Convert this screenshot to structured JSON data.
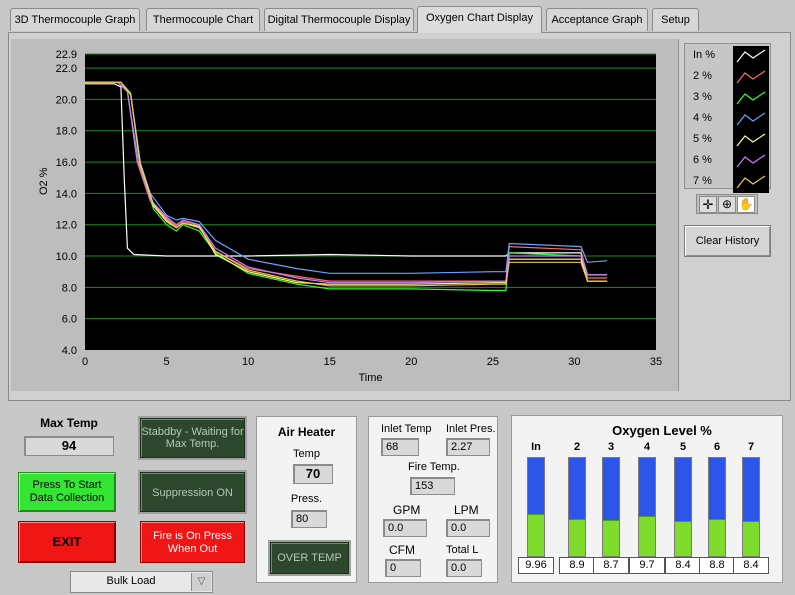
{
  "tabs": [
    "3D Thermocouple Graph",
    "Thermocouple Chart",
    "Digital Thermocouple Display",
    "Oxygen Chart Display",
    "Acceptance Graph",
    "Setup"
  ],
  "chart_data": {
    "type": "line",
    "xlabel": "Time",
    "ylabel": "O2 %",
    "xlim": [
      0,
      35
    ],
    "ylim": [
      4.0,
      22.9
    ],
    "x_ticks": [
      "0",
      "5",
      "10",
      "15",
      "20",
      "25",
      "30",
      "35"
    ],
    "y_ticks": [
      "4.0",
      "6.0",
      "8.0",
      "10.0",
      "12.0",
      "14.0",
      "16.0",
      "18.0",
      "20.0",
      "22.0",
      "22.9"
    ],
    "grid": true,
    "series": [
      {
        "name": "In %",
        "color": "#ffffff",
        "x": [
          0,
          1.8,
          2.2,
          2.4,
          2.6,
          3,
          5,
          10,
          15,
          20,
          25,
          25.8,
          26,
          30.4,
          30.8,
          32
        ],
        "y": [
          21.0,
          21.0,
          20.8,
          15,
          10.5,
          10.1,
          10.0,
          10.0,
          10.1,
          10.0,
          10.0,
          10.0,
          10.2,
          10.2,
          8.8,
          8.8
        ]
      },
      {
        "name": "2 %",
        "color": "#ff6a6a",
        "x": [
          0,
          2,
          2.6,
          3.2,
          4,
          5,
          5.6,
          6,
          7,
          8,
          10,
          13,
          15,
          20,
          25,
          25.8,
          26,
          30.4,
          30.8,
          32
        ],
        "y": [
          21.1,
          21.1,
          20.6,
          16,
          13.5,
          12.4,
          11.9,
          12.2,
          12.0,
          10.3,
          9.2,
          8.7,
          8.4,
          8.4,
          8.4,
          8.4,
          10.6,
          10.4,
          8.6,
          8.6
        ]
      },
      {
        "name": "3 %",
        "color": "#33ff33",
        "x": [
          0,
          2.2,
          2.8,
          3.4,
          4.2,
          5,
          5.6,
          6,
          7,
          8,
          10,
          13,
          15,
          20,
          25,
          25.8,
          26,
          30.4,
          30.8,
          32
        ],
        "y": [
          21.1,
          21.1,
          20.4,
          15.5,
          13.0,
          12.0,
          11.6,
          12.0,
          11.6,
          10.2,
          8.9,
          8.2,
          7.9,
          7.9,
          7.8,
          7.8,
          10.2,
          10.0,
          8.4,
          8.4
        ]
      },
      {
        "name": "4 %",
        "color": "#6aa2ff",
        "x": [
          0,
          2,
          2.6,
          3.2,
          4,
          5,
          5.6,
          6,
          7,
          8,
          10,
          13,
          15,
          20,
          25,
          25.8,
          26,
          30.4,
          30.8,
          32
        ],
        "y": [
          21.1,
          21.1,
          20.5,
          16.5,
          14.0,
          12.6,
          12.3,
          12.4,
          12.2,
          11.0,
          9.8,
          9.2,
          8.9,
          8.9,
          9.0,
          9.0,
          10.8,
          10.6,
          9.6,
          9.7
        ]
      },
      {
        "name": "5 %",
        "color": "#ffff88",
        "x": [
          0,
          2.2,
          2.8,
          3.4,
          4.2,
          5,
          5.6,
          6,
          7,
          8,
          10,
          13,
          15,
          20,
          25,
          25.8,
          26,
          30.4,
          30.8,
          32
        ],
        "y": [
          21.1,
          21.1,
          20.3,
          15.8,
          13.2,
          12.2,
          11.8,
          12.1,
          11.9,
          10.1,
          9.0,
          8.3,
          8.2,
          8.2,
          8.3,
          8.3,
          9.8,
          9.8,
          8.4,
          8.4
        ]
      },
      {
        "name": "6 %",
        "color": "#c77dff",
        "x": [
          0,
          2,
          2.6,
          3.2,
          4,
          5,
          5.6,
          6,
          7,
          8,
          10,
          13,
          15,
          20,
          25,
          25.8,
          26,
          30.4,
          30.8,
          32
        ],
        "y": [
          21.1,
          21.1,
          20.5,
          16.2,
          13.6,
          12.5,
          12.0,
          12.3,
          12.0,
          10.5,
          9.3,
          8.6,
          8.3,
          8.3,
          8.4,
          8.4,
          10.0,
          10.0,
          8.8,
          8.8
        ]
      },
      {
        "name": "7 %",
        "color": "#f4c542",
        "x": [
          0,
          2.2,
          2.8,
          3.4,
          4.2,
          5,
          5.6,
          6,
          7,
          8,
          10,
          13,
          15,
          20,
          25,
          25.8,
          26,
          30.4,
          30.8,
          32
        ],
        "y": [
          21.1,
          21.1,
          20.3,
          15.9,
          13.3,
          12.3,
          11.8,
          12.1,
          11.8,
          10.3,
          9.1,
          8.4,
          8.1,
          8.1,
          8.2,
          8.2,
          9.6,
          9.6,
          8.4,
          8.4
        ]
      }
    ]
  },
  "legend": {
    "items": [
      {
        "label": "In %",
        "color": "#ffffff"
      },
      {
        "label": "2 %",
        "color": "#ff6a6a"
      },
      {
        "label": "3 %",
        "color": "#33ff33"
      },
      {
        "label": "4 %",
        "color": "#6aa2ff"
      },
      {
        "label": "5 %",
        "color": "#ffff88"
      },
      {
        "label": "6 %",
        "color": "#c77dff"
      },
      {
        "label": "7 %",
        "color": "#f4c542"
      }
    ]
  },
  "clear_history_label": "Clear History",
  "max_temp": {
    "label": "Max Temp",
    "value": "94"
  },
  "buttons": {
    "start": "Press To Start Data Collection",
    "exit": "EXIT",
    "standby": "Stabdby - Waiting for Max Temp.",
    "suppression": "Suppression ON",
    "fire": "Fire is On Press When Out",
    "over_temp": "OVER TEMP"
  },
  "load_select": {
    "value": "Bulk Load"
  },
  "air_heater": {
    "title": "Air Heater",
    "temp_label": "Temp",
    "temp_value": "70",
    "press_label": "Press.",
    "press_value": "80"
  },
  "inlet": {
    "inlet_temp_label": "Inlet Temp",
    "inlet_temp_value": "68",
    "inlet_pres_label": "Inlet Pres.",
    "inlet_pres_value": "2.27",
    "fire_temp_label": "Fire Temp.",
    "fire_temp_value": "153",
    "gpm_label": "GPM",
    "gpm_value": "0.0",
    "lpm_label": "LPM",
    "lpm_value": "0.0",
    "cfm_label": "CFM",
    "cfm_value": "0",
    "total_l_label": "Total L",
    "total_l_value": "0.0"
  },
  "oxygen_level": {
    "title": "Oxygen Level %",
    "tanks": [
      {
        "label": "In",
        "value": "9.96",
        "fill": 0.43
      },
      {
        "label": "2",
        "value": "8.9",
        "fill": 0.38
      },
      {
        "label": "3",
        "value": "8.7",
        "fill": 0.37
      },
      {
        "label": "4",
        "value": "9.7",
        "fill": 0.41
      },
      {
        "label": "5",
        "value": "8.4",
        "fill": 0.36
      },
      {
        "label": "6",
        "value": "8.8",
        "fill": 0.38
      },
      {
        "label": "7",
        "value": "8.4",
        "fill": 0.36
      }
    ]
  }
}
